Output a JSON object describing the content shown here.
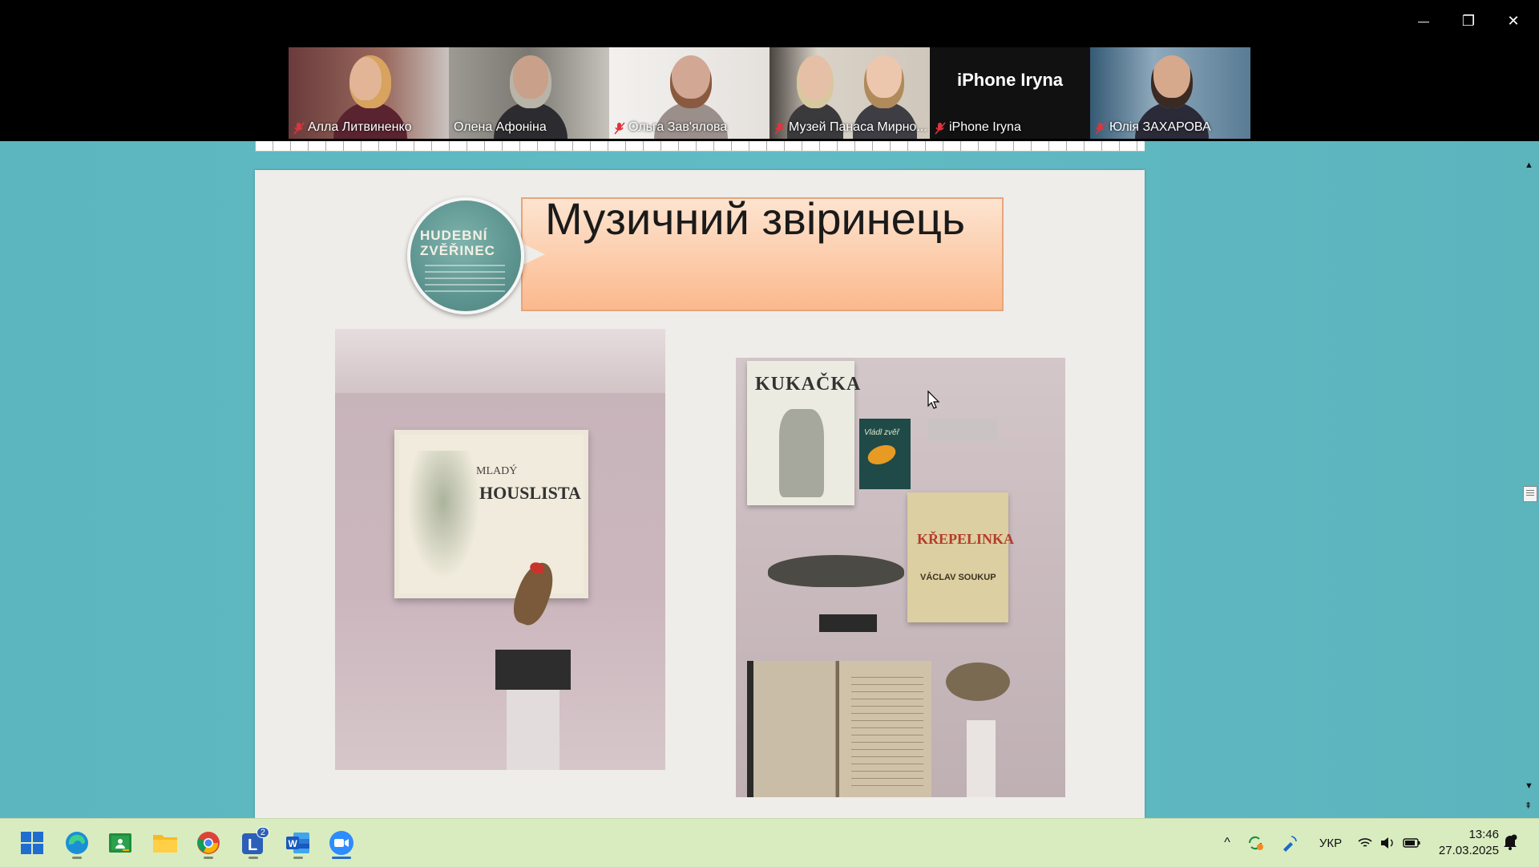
{
  "window": {
    "minimize_glyph": "—",
    "restore_glyph": "❐",
    "close_glyph": "✕"
  },
  "participants": [
    {
      "name": "Алла Литвиненко",
      "muted": true,
      "color_bg": "#7a4a4a",
      "color_head": "#e6b49a",
      "color_body": "#5a2330"
    },
    {
      "name": "Олена Афоніна",
      "muted": false,
      "active": true,
      "color_bg": "#8f8c84",
      "color_head": "#c9a08a",
      "color_body": "#2c2c30"
    },
    {
      "name": "Ольга Зав'ялова",
      "muted": true,
      "color_bg": "#e7e4e0",
      "color_head": "#d2a894",
      "color_body": "#7a6d68"
    },
    {
      "name": "Музей Панаса Мирно...",
      "muted": true,
      "color_bg": "#d5cfc4",
      "color_head": "#e5c0a6",
      "color_body": "#3a3a3c"
    },
    {
      "name": "iPhone Iryna",
      "muted": true,
      "video_off": true,
      "big_label": "iPhone Iryna",
      "color_bg": "#111111"
    },
    {
      "name": "Юлія ЗАХАРОВА",
      "muted": true,
      "color_bg": "#4e6d82",
      "color_head": "#d6a98c",
      "color_body": "#2a2a38"
    }
  ],
  "slide": {
    "title": "Музичний звіринець",
    "logo_line1": "HUDEBNÍ",
    "logo_line2": "ZVĚŘINEC",
    "photo1_text1": "MLADÝ",
    "photo1_text2": "HOUSLISTA",
    "photo2_text1": "KUKAČKA",
    "photo2_book_text": "Vládl zvěř",
    "photo2_text2": "KŘEPELINKA",
    "photo2_text3": "VÁCLAV SOUKUP"
  },
  "tray": {
    "language": "УКР",
    "time": "13:46",
    "date": "27.03.2025",
    "notification_count": "2"
  },
  "taskbar_apps": [
    "start",
    "edge",
    "classroom",
    "file-explorer",
    "chrome",
    "lms",
    "word",
    "zoom"
  ],
  "colors": {
    "active_speaker": "#23d961",
    "muted_mic": "#e0343c",
    "taskbar_bg": "#d9ecc0",
    "doc_bg": "#5fb8c1"
  }
}
